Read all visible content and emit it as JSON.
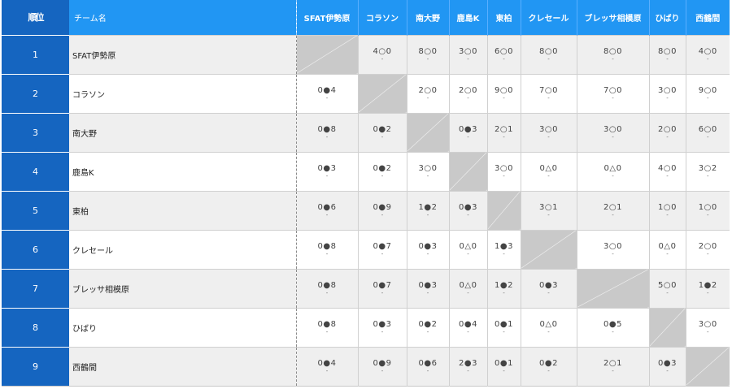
{
  "header": {
    "rank_label": "順位",
    "team_label": "チーム名"
  },
  "teams": [
    "SFAT伊勢原",
    "コラソン",
    "南大野",
    "鹿島K",
    "東柏",
    "クレセール",
    "ブレッサ相模原",
    "ひばり",
    "西鶴間"
  ],
  "rows": [
    {
      "rank": "1",
      "team": "SFAT伊勢原",
      "results": [
        null,
        "4○0",
        "8○0",
        "3○0",
        "6○0",
        "8○0",
        "8○0",
        "8○0",
        "4○0"
      ]
    },
    {
      "rank": "2",
      "team": "コラソン",
      "results": [
        "0●4",
        null,
        "2○0",
        "2○0",
        "9○0",
        "7○0",
        "7○0",
        "3○0",
        "9○0"
      ]
    },
    {
      "rank": "3",
      "team": "南大野",
      "results": [
        "0●8",
        "0●2",
        null,
        "0●3",
        "2○1",
        "3○0",
        "3○0",
        "2○0",
        "6○0"
      ]
    },
    {
      "rank": "4",
      "team": "鹿島K",
      "results": [
        "0●3",
        "0●2",
        "3○0",
        null,
        "3○0",
        "0△0",
        "0△0",
        "4○0",
        "3○2"
      ]
    },
    {
      "rank": "5",
      "team": "東柏",
      "results": [
        "0●6",
        "0●9",
        "1●2",
        "0●3",
        null,
        "3○1",
        "2○1",
        "1○0",
        "1○0"
      ]
    },
    {
      "rank": "6",
      "team": "クレセール",
      "results": [
        "0●8",
        "0●7",
        "0●3",
        "0△0",
        "1●3",
        null,
        "3○0",
        "0△0",
        "2○0"
      ]
    },
    {
      "rank": "7",
      "team": "ブレッサ相模原",
      "results": [
        "0●8",
        "0●7",
        "0●3",
        "0△0",
        "1●2",
        "0●3",
        null,
        "5○0",
        "1●2"
      ]
    },
    {
      "rank": "8",
      "team": "ひばり",
      "results": [
        "0●8",
        "0●3",
        "0●2",
        "0●4",
        "0●1",
        "0△0",
        "0●5",
        null,
        "3○0"
      ]
    },
    {
      "rank": "9",
      "team": "西鶴間",
      "results": [
        "0●4",
        "0●9",
        "0●6",
        "2●3",
        "0●1",
        "0●2",
        "2○1",
        "0●3",
        null
      ]
    }
  ],
  "sub_mark": "-",
  "colors": {
    "header_blue": "#2196f3",
    "rank_blue": "#1565c0",
    "self_cell": "#c9c9c9",
    "row_alt": "#efefef"
  }
}
